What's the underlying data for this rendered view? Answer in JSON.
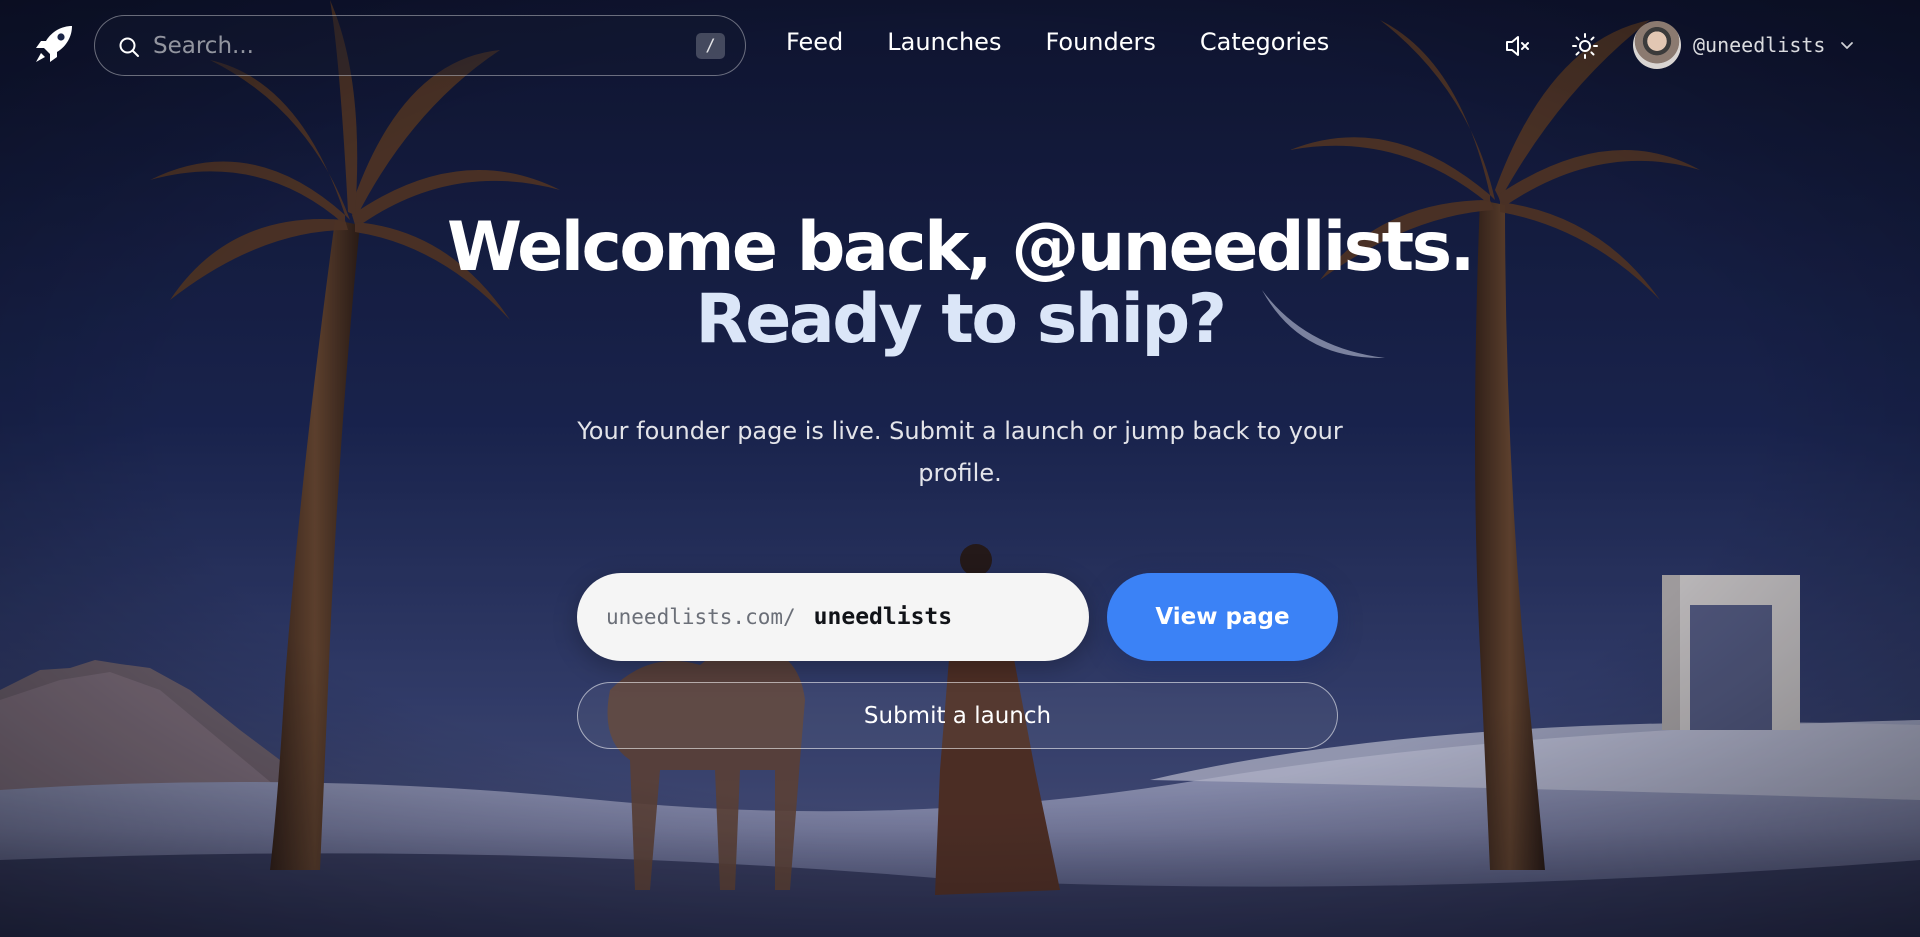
{
  "search": {
    "placeholder": "Search...",
    "shortcut": "/"
  },
  "nav": {
    "links": [
      {
        "label": "Feed"
      },
      {
        "label": "Launches"
      },
      {
        "label": "Founders"
      },
      {
        "label": "Categories"
      }
    ]
  },
  "user": {
    "handle": "@uneedlists"
  },
  "icons": {
    "logo": "rocket-icon",
    "search": "search-icon",
    "mute": "speaker-muted-icon",
    "theme": "sun-icon",
    "dropdown": "chevron-down-icon"
  },
  "hero": {
    "title_line1": "Welcome back, @uneedlists.",
    "title_line2": "Ready to ship?",
    "subtitle": "Your founder page is live. Submit a launch or jump back to your profile.",
    "url_prefix": "uneedlists.com/",
    "url_value": "uneedlists",
    "view_button": "View page",
    "submit_button": "Submit a launch"
  },
  "colors": {
    "accent": "#3b82f6",
    "sky_top": "#131a3a",
    "sky_bottom": "#35406a",
    "title_secondary": "#dbe6f8"
  }
}
